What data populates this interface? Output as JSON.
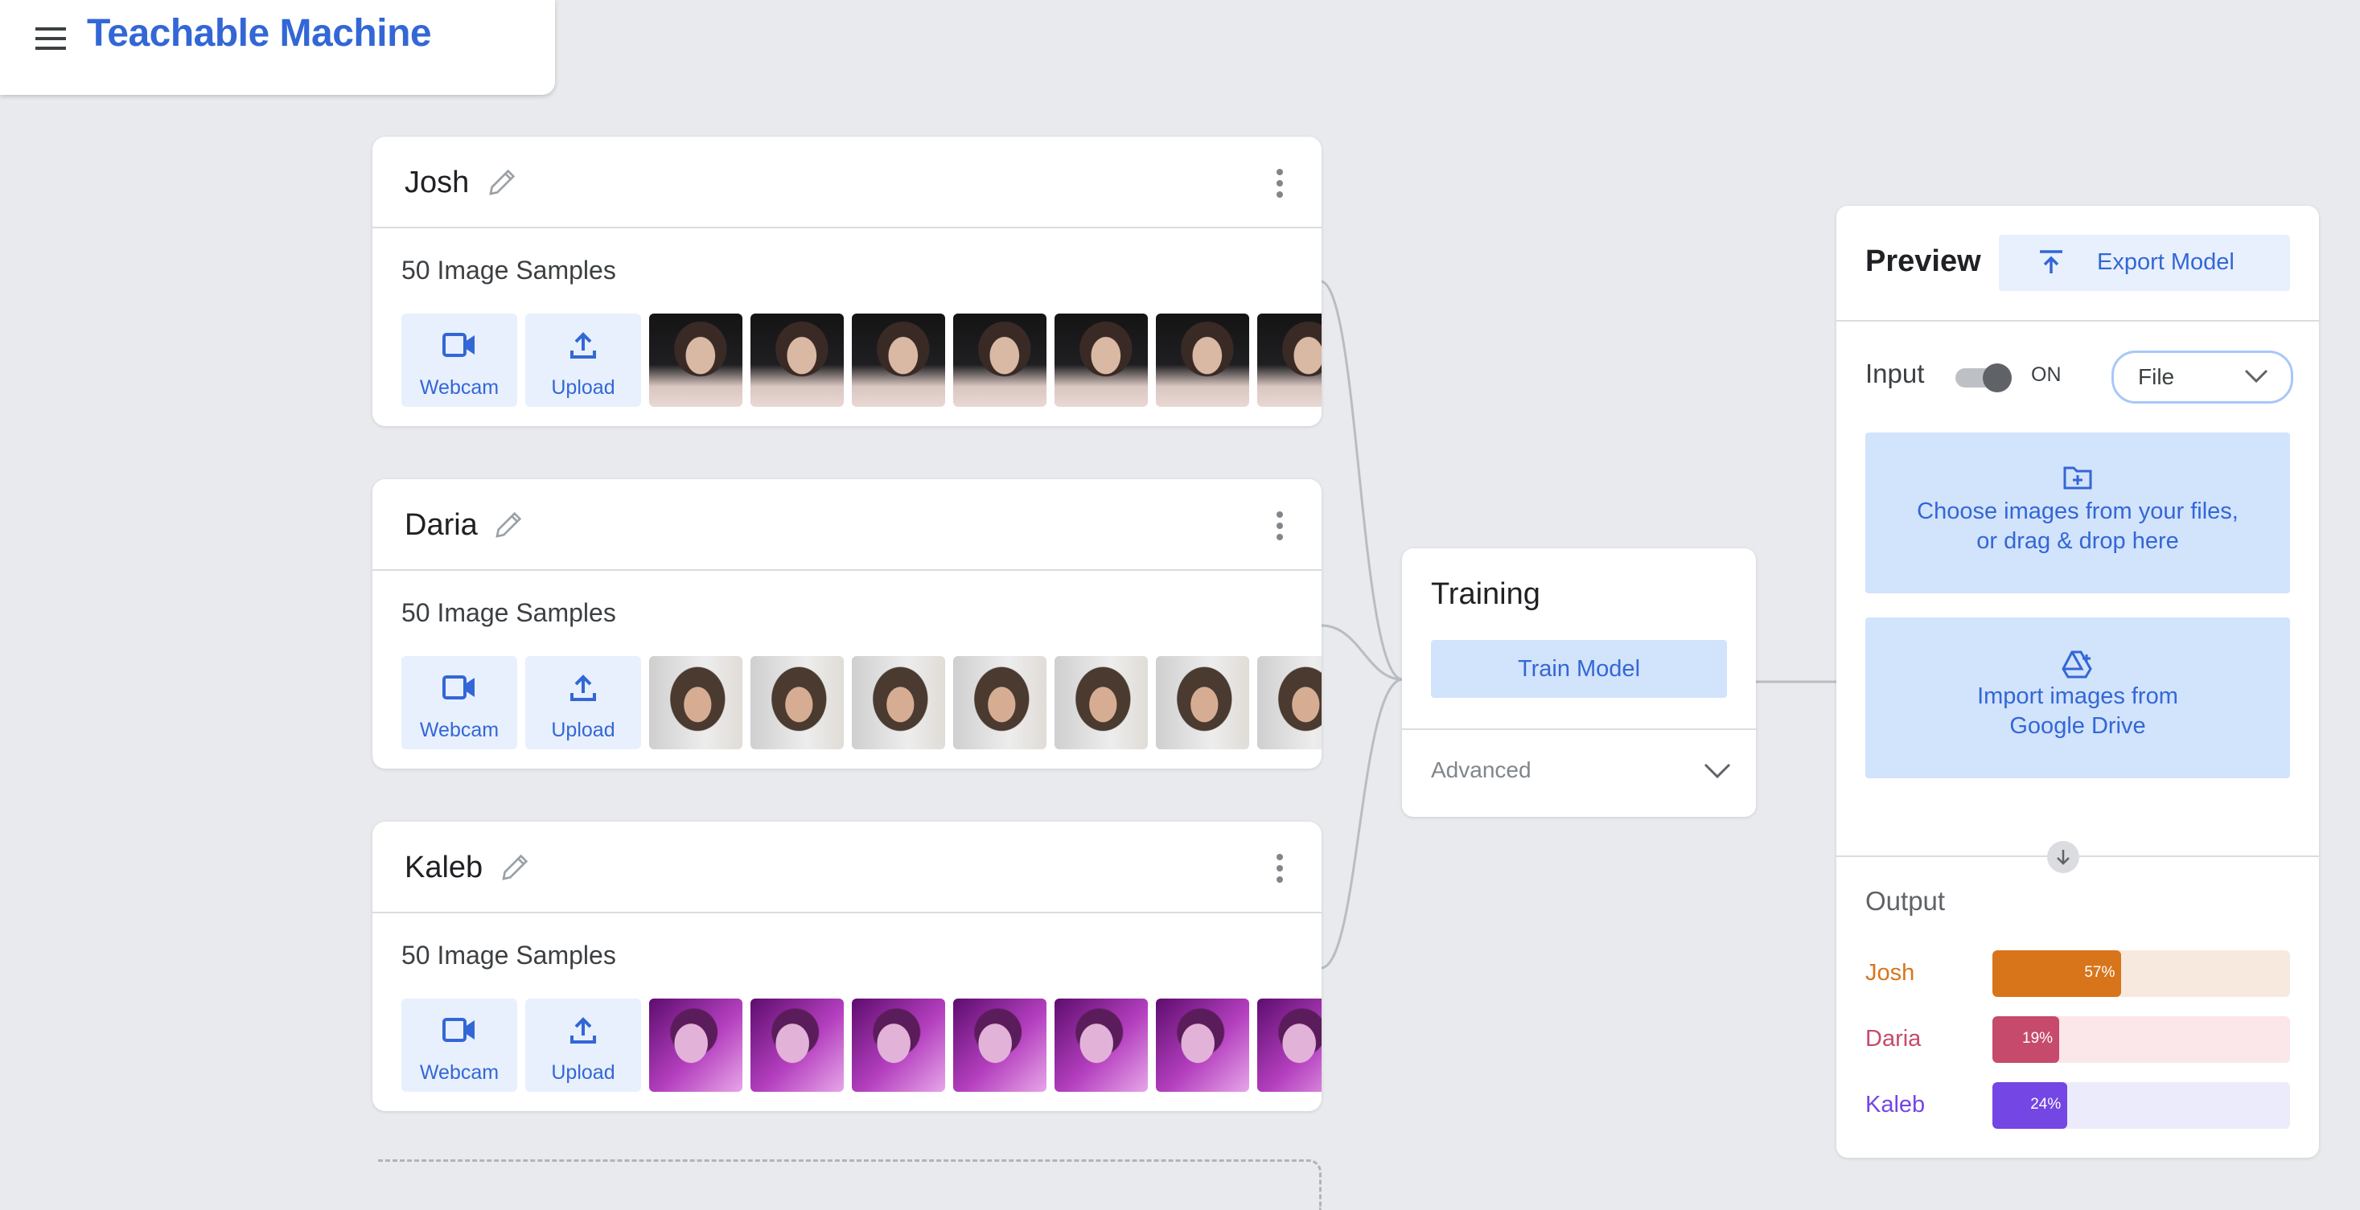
{
  "app": {
    "title": "Teachable Machine"
  },
  "classes": [
    {
      "name": "Josh",
      "samples": "50 Image Samples",
      "webcam_label": "Webcam",
      "upload_label": "Upload",
      "thumbs": 7
    },
    {
      "name": "Daria",
      "samples": "50 Image Samples",
      "webcam_label": "Webcam",
      "upload_label": "Upload",
      "thumbs": 7
    },
    {
      "name": "Kaleb",
      "samples": "50 Image Samples",
      "webcam_label": "Webcam",
      "upload_label": "Upload",
      "thumbs": 7
    }
  ],
  "training": {
    "title": "Training",
    "train_label": "Train Model",
    "advanced_label": "Advanced"
  },
  "preview": {
    "title": "Preview",
    "export_label": "Export Model",
    "input_label": "Input",
    "toggle_state": "ON",
    "input_source": "File",
    "choose_files_line1": "Choose images from your files,",
    "choose_files_line2": "or drag & drop here",
    "import_drive_line1": "Import images from",
    "import_drive_line2": "Google Drive",
    "output_title": "Output",
    "outputs": [
      {
        "label": "Josh",
        "percent": 57,
        "percent_text": "57%",
        "color": "#d8751b",
        "track": "#f8e9df"
      },
      {
        "label": "Daria",
        "percent": 19,
        "percent_text": "19%",
        "color": "#c64a6b",
        "track": "#fbe6ea"
      },
      {
        "label": "Kaleb",
        "percent": 24,
        "percent_text": "24%",
        "color": "#7446e3",
        "track": "#ecebfb"
      }
    ]
  },
  "colors": {
    "accent": "#3367d6",
    "button_bg": "#e8f0fe",
    "panel_bg": "#e8eaed"
  },
  "icons": [
    "menu-icon",
    "pencil-icon",
    "more-vert-icon",
    "videocam-icon",
    "upload-icon",
    "export-icon",
    "chevron-down-icon",
    "folder-add-icon",
    "google-drive-icon",
    "arrow-down-icon"
  ]
}
